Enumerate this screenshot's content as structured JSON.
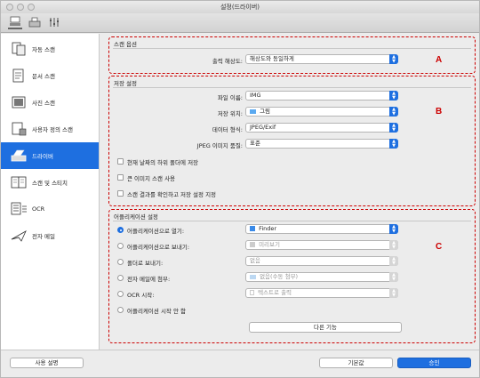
{
  "window": {
    "title": "설정(드라이버)"
  },
  "toolbar": {
    "tabs": [
      {
        "name": "scan-from-computer-icon"
      },
      {
        "name": "scan-from-panel-icon"
      },
      {
        "name": "general-settings-icon"
      }
    ]
  },
  "sidebar": {
    "items": [
      {
        "label": "자동 스캔",
        "icon": "auto-scan-icon"
      },
      {
        "label": "문서 스캔",
        "icon": "document-scan-icon"
      },
      {
        "label": "사진 스캔",
        "icon": "photo-scan-icon"
      },
      {
        "label": "사용자 정의 스캔",
        "icon": "custom-scan-icon"
      },
      {
        "label": "드라이버",
        "icon": "driver-icon",
        "active": true
      },
      {
        "label": "스캔 및 스티치",
        "icon": "scan-stitch-icon"
      },
      {
        "label": "OCR",
        "icon": "ocr-icon"
      },
      {
        "label": "전자 메일",
        "icon": "email-icon"
      }
    ]
  },
  "scan_options": {
    "title": "스캔 옵션",
    "resolution_label": "출력 해상도:",
    "resolution_value": "해상도와 동일하게",
    "marker": "A"
  },
  "save_settings": {
    "title": "저장 설정",
    "marker": "B",
    "file_name_label": "파일 이름:",
    "file_name_value": "IMG",
    "save_in_label": "저장 위치:",
    "save_in_value": "그림",
    "data_format_label": "데이터 형식:",
    "data_format_value": "JPEG/Exif",
    "jpeg_quality_label": "JPEG 이미지 품질:",
    "jpeg_quality_value": "표준",
    "checkboxes": [
      "현재 날짜의 하위 폴더에 저장",
      "큰 이미지 스캔 사용",
      "스캔 결과를 확인하고 저장 설정 지정"
    ]
  },
  "app_settings": {
    "title": "어플리케이션 설정",
    "marker": "C",
    "options": [
      {
        "label": "어플리케이션으로 열기:",
        "value": "Finder",
        "selected": true
      },
      {
        "label": "어플리케이션으로 보내기:",
        "value": "미리보기"
      },
      {
        "label": "폴더로 보내기:",
        "value": "없음"
      },
      {
        "label": "전자 메일에 첨부:",
        "value": "없음(수동 첨부)"
      },
      {
        "label": "OCR 시작:",
        "value": "텍스트로 출력"
      },
      {
        "label": "어플리케이션 시작 안 함",
        "value": null
      }
    ],
    "more_functions": "다른 기능"
  },
  "footer": {
    "help": "사용 설명",
    "defaults": "기본값",
    "ok": "승인"
  },
  "colors": {
    "accent": "#1e6fe0",
    "marker": "#cc0000"
  }
}
